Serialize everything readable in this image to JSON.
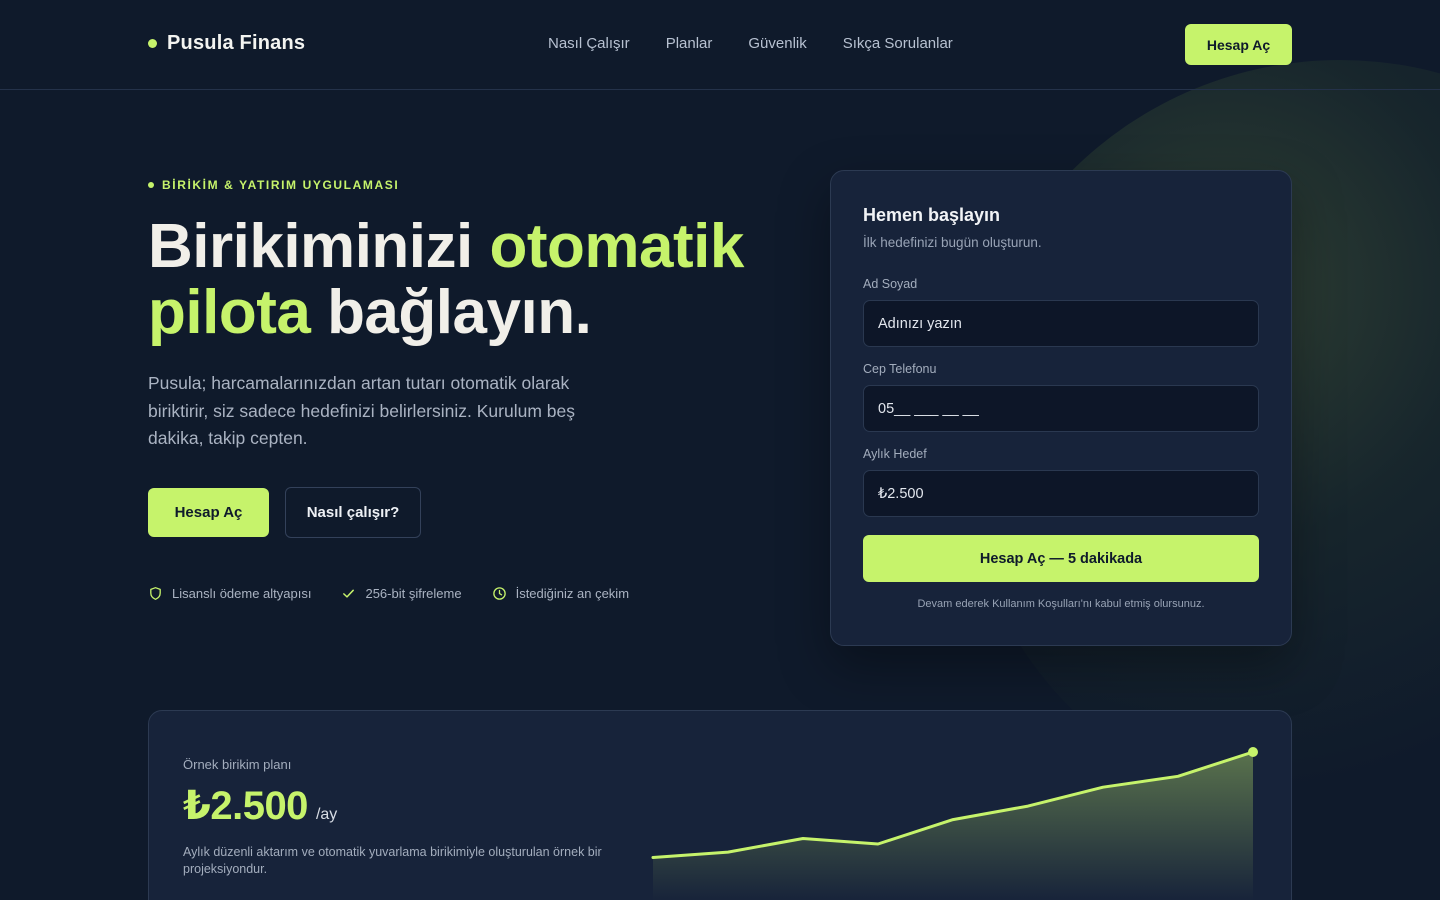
{
  "brand": {
    "name": "Pusula Finans"
  },
  "nav": {
    "items": [
      "Nasıl Çalışır",
      "Planlar",
      "Güvenlik",
      "Sıkça Sorulanlar"
    ],
    "cta": "Hesap Aç"
  },
  "hero": {
    "eyebrow": "BİRİKİM & YATIRIM UYGULAMASI",
    "headline_part1": "Birikiminizi",
    "headline_accent1": "otomatik",
    "headline_accent2": "pilota",
    "headline_part2": "bağlayın.",
    "lead": "Pusula; harcamalarınızdan artan tutarı otomatik olarak biriktirir, siz sadece hedefinizi belirlersiniz. Kurulum beş dakika, takip cepten.",
    "primary_cta": "Hesap Aç",
    "secondary_cta": "Nasıl çalışır?",
    "features": [
      {
        "icon": "shield-icon",
        "label": "Lisanslı ödeme altyapısı"
      },
      {
        "icon": "check-icon",
        "label": "256-bit şifreleme"
      },
      {
        "icon": "clock-icon",
        "label": "İstediğiniz an çekim"
      }
    ]
  },
  "form": {
    "title": "Hemen başlayın",
    "subtitle": "İlk hedefinizi bugün oluşturun.",
    "name_label": "Ad Soyad",
    "name_placeholder": "Adınızı yazın",
    "phone_label": "Cep Telefonu",
    "phone_placeholder": "05__ ___ __ __",
    "goal_label": "Aylık Hedef",
    "goal_value": "₺2.500",
    "submit": "Hesap Aç — 5 dakikada",
    "terms": "Devam ederek Kullanım Koşulları'nı kabul etmiş olursunuz."
  },
  "plan": {
    "label": "Örnek birikim planı",
    "amount": "₺2.500",
    "unit": "/ay",
    "description": "Aylık düzenli aktarım ve otomatik yuvarlama birikimiyle oluşturulan örnek bir projeksiyondur."
  },
  "chart_data": {
    "type": "area",
    "values": [
      10,
      14,
      24,
      20,
      38,
      48,
      62,
      70,
      88
    ]
  },
  "colors": {
    "background": "#0f1a2b",
    "accent": "#c6f36b",
    "card": "#17233a"
  }
}
